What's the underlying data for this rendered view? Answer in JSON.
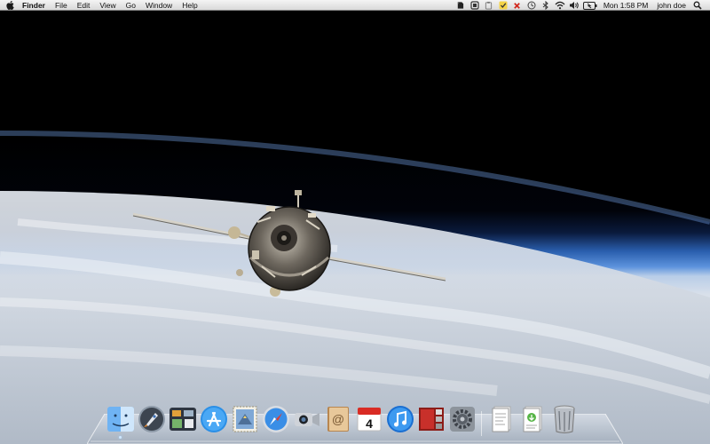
{
  "menubar": {
    "apple_icon": "apple-icon",
    "app_name": "Finder",
    "menus": [
      "File",
      "Edit",
      "View",
      "Go",
      "Window",
      "Help"
    ],
    "status_icons": [
      "evernote-icon",
      "dropbox-icon",
      "clipboard-icon",
      "checkmark-icon",
      "close-x-icon",
      "time-machine-icon",
      "bluetooth-icon",
      "wifi-icon",
      "volume-icon",
      "battery-icon"
    ],
    "clock": "Mon 1:58 PM",
    "user": "john doe",
    "spotlight_icon": "spotlight-search-icon"
  },
  "dock": {
    "apps": [
      {
        "name": "Finder",
        "icon": "finder-icon",
        "running": true
      },
      {
        "name": "Launchpad",
        "icon": "launchpad-rocket-icon",
        "running": false
      },
      {
        "name": "Mission Control",
        "icon": "mission-control-icon",
        "running": false
      },
      {
        "name": "App Store",
        "icon": "app-store-icon",
        "running": false
      },
      {
        "name": "Mail",
        "icon": "mail-stamp-icon",
        "running": false
      },
      {
        "name": "Safari",
        "icon": "safari-compass-icon",
        "running": false
      },
      {
        "name": "FaceTime",
        "icon": "facetime-camera-icon",
        "running": false
      },
      {
        "name": "Address Book",
        "icon": "address-book-icon",
        "running": false
      },
      {
        "name": "iCal",
        "icon": "calendar-icon",
        "running": false,
        "calendar_day": "4"
      },
      {
        "name": "iTunes",
        "icon": "itunes-note-icon",
        "running": false
      },
      {
        "name": "Photo Booth",
        "icon": "photo-booth-icon",
        "running": false
      },
      {
        "name": "System Preferences",
        "icon": "system-preferences-gear-icon",
        "running": false
      }
    ],
    "docs": [
      {
        "name": "Documents",
        "icon": "documents-stack-icon"
      },
      {
        "name": "Downloads",
        "icon": "downloads-stack-icon"
      },
      {
        "name": "Trash",
        "icon": "trash-can-icon"
      }
    ]
  },
  "colors": {
    "menubar_top": "#f4f4f4",
    "menubar_bottom": "#d9d9d9",
    "space": "#000000",
    "atmosphere": "#3f7fd6",
    "clouds": "#d7dde6"
  }
}
